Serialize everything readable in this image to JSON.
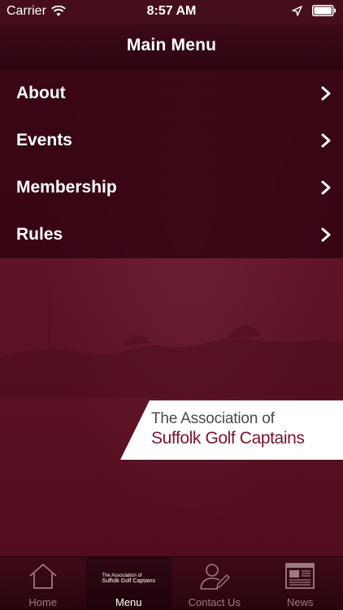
{
  "status_bar": {
    "carrier": "Carrier",
    "time": "8:57 AM"
  },
  "nav": {
    "title": "Main Menu"
  },
  "menu": {
    "items": [
      {
        "label": "About"
      },
      {
        "label": "Events"
      },
      {
        "label": "Membership"
      },
      {
        "label": "Rules"
      }
    ]
  },
  "logo": {
    "line1": "The Association of",
    "line2": "Suffolk Golf Captains"
  },
  "tab_bar": {
    "tabs": [
      {
        "label": "Home",
        "icon": "home-icon"
      },
      {
        "label": "Menu",
        "icon": "logo-icon",
        "active": true
      },
      {
        "label": "Contact Us",
        "icon": "contact-icon"
      },
      {
        "label": "News",
        "icon": "news-icon"
      }
    ],
    "mini_logo_line1": "The Association of",
    "mini_logo_line2": "Suffolk Golf Captains"
  },
  "colors": {
    "background": "#5a1022",
    "nav_bar": "#2e0510",
    "logo_text_accent": "#7a1430",
    "tab_inactive": "#a07a83",
    "tab_active": "#ffffff"
  }
}
